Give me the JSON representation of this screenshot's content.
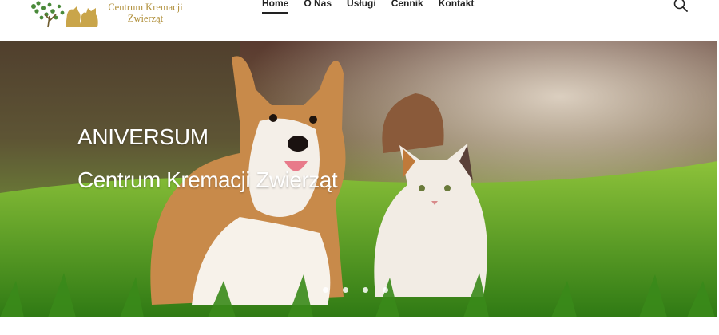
{
  "header": {
    "logo": {
      "line1": "Centrum Kremacji",
      "line2": "Zwierząt",
      "mark_icon": "paw-tree-logo-icon"
    },
    "nav": [
      {
        "label": "Home",
        "active": true
      },
      {
        "label": "O Nas",
        "active": false
      },
      {
        "label": "Usługi",
        "active": false
      },
      {
        "label": "Cennik",
        "active": false
      },
      {
        "label": "Kontakt",
        "active": false
      }
    ],
    "search_icon": "search-icon"
  },
  "hero": {
    "title": "ANIVERSUM",
    "subtitle": "Centrum Kremacji Zwierząt",
    "image": "corgi-and-cat-on-grass-photo",
    "slides": 4,
    "active_slide": 1
  },
  "colors": {
    "logo_gold": "#b08f3a",
    "logo_green": "#4a8a3a",
    "nav_text": "#222222",
    "hero_text": "#ffffff"
  }
}
